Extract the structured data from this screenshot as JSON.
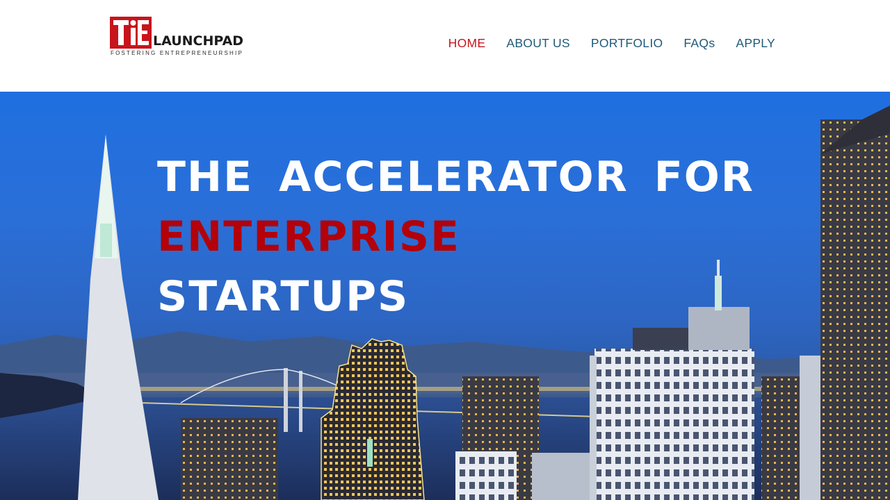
{
  "logo": {
    "mark": "TiE",
    "word": "LAUNCHPAD",
    "tagline": "FOSTERING ENTREPRENEURSHIP"
  },
  "nav": [
    {
      "label": "HOME",
      "active": true
    },
    {
      "label": "ABOUT US",
      "active": false
    },
    {
      "label": "PORTFOLIO",
      "active": false
    },
    {
      "label": "FAQs",
      "active": false
    },
    {
      "label": "APPLY",
      "active": false
    }
  ],
  "hero": {
    "line1": "THE ACCELERATOR FOR",
    "line2": "ENTERPRISE",
    "line3": "STARTUPS"
  },
  "colors": {
    "accent_red": "#c8141c",
    "nav_blue": "#1f5a78",
    "headline_red": "#b3020a"
  }
}
